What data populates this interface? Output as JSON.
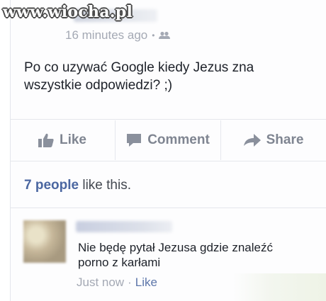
{
  "watermark": "www.wiocha.pl",
  "post": {
    "timestamp": "16 minutes ago",
    "text": "Po co uzywać Google kiedy Jezus zna wszystkie odpowiedzi? ;)"
  },
  "actions": {
    "like": "Like",
    "comment": "Comment",
    "share": "Share"
  },
  "likes": {
    "count_text": "7 people",
    "suffix": "like this."
  },
  "comment": {
    "text": "Nie będę pytał Jezusa gdzie znaleźć porno z karłami",
    "timestamp": "Just now",
    "like": "Like"
  },
  "colors": {
    "link": "#4b67a1",
    "muted": "#a4a9b4",
    "action": "#7f8591"
  },
  "icons": [
    "group-audience-icon",
    "thumbs-up-icon",
    "comment-bubble-icon",
    "share-arrow-icon"
  ]
}
